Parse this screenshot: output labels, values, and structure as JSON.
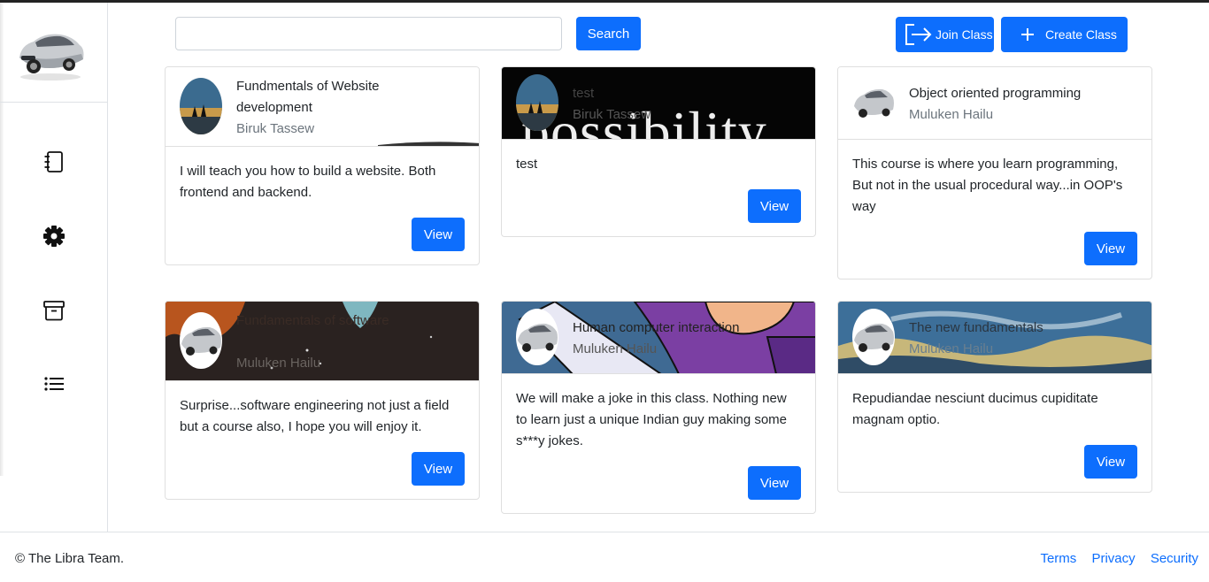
{
  "search": {
    "placeholder": "",
    "value": "",
    "button_label": "Search"
  },
  "actions": {
    "join_label": "Join Class",
    "create_label": "Create Class"
  },
  "colors": {
    "primary": "#0d6efd",
    "muted": "#6c757d",
    "border": "#dfdfdf"
  },
  "sidebar": {
    "items": [
      {
        "icon": "notebook-icon"
      },
      {
        "icon": "gear-icon"
      },
      {
        "icon": "archive-icon"
      },
      {
        "icon": "list-icon"
      }
    ]
  },
  "classes": [
    {
      "title": "Fundmentals of Website development",
      "teacher": "Biruk Tassew",
      "description": "I will teach you how to build a website. Both frontend and backend.",
      "view_label": "View"
    },
    {
      "title": "test",
      "teacher": "Biruk Tassew",
      "description": "test",
      "view_label": "View",
      "banner_text": "possibility"
    },
    {
      "title": "Object oriented programming",
      "teacher": "Muluken Hailu",
      "description": "This course is where you learn programming, But not in the usual procedural way...in OOP's way",
      "view_label": "View"
    },
    {
      "title": "Fundamentals of software",
      "teacher": "Muluken Hailu",
      "description": "Surprise...software engineering not just a field but a course also, I hope you will enjoy it.",
      "view_label": "View"
    },
    {
      "title": "Human computer interaction",
      "teacher": "Muluken Hailu",
      "description": "We will make a joke in this class. Nothing new to learn just a unique Indian guy making some s***y jokes.",
      "view_label": "View"
    },
    {
      "title": "The new fundamentals",
      "teacher": "Muluken Hailu",
      "description": "Repudiandae nesciunt ducimus cupiditate magnam optio.",
      "view_label": "View"
    }
  ],
  "footer": {
    "copyright": "© The Libra Team.",
    "links": [
      "Terms",
      "Privacy",
      "Security"
    ]
  }
}
